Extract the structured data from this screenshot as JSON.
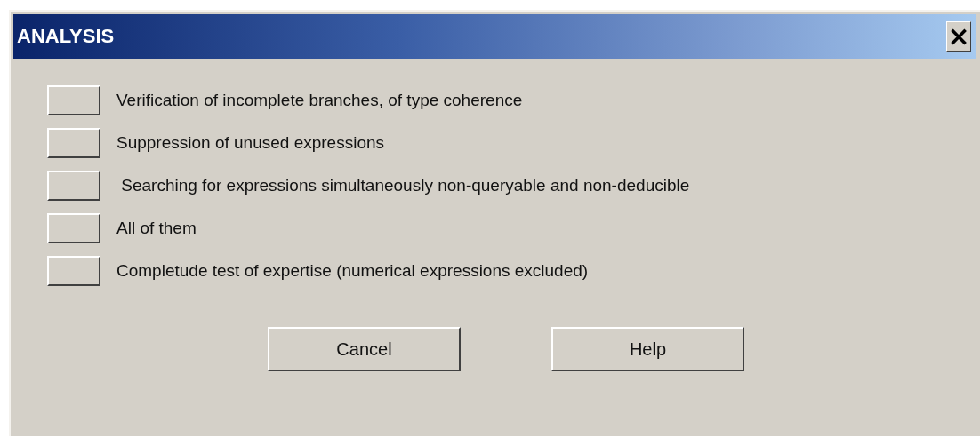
{
  "window": {
    "title": "ANALYSIS",
    "close": "×"
  },
  "options": [
    {
      "label": "Verification of incomplete branches, of type coherence"
    },
    {
      "label": "Suppression of unused expressions"
    },
    {
      "label": " Searching for expressions simultaneously non-queryable and non-deducible"
    },
    {
      "label": "All of them"
    },
    {
      "label": "Completude test of expertise (numerical expressions excluded)"
    }
  ],
  "buttons": [
    "Cancel",
    "Help"
  ]
}
